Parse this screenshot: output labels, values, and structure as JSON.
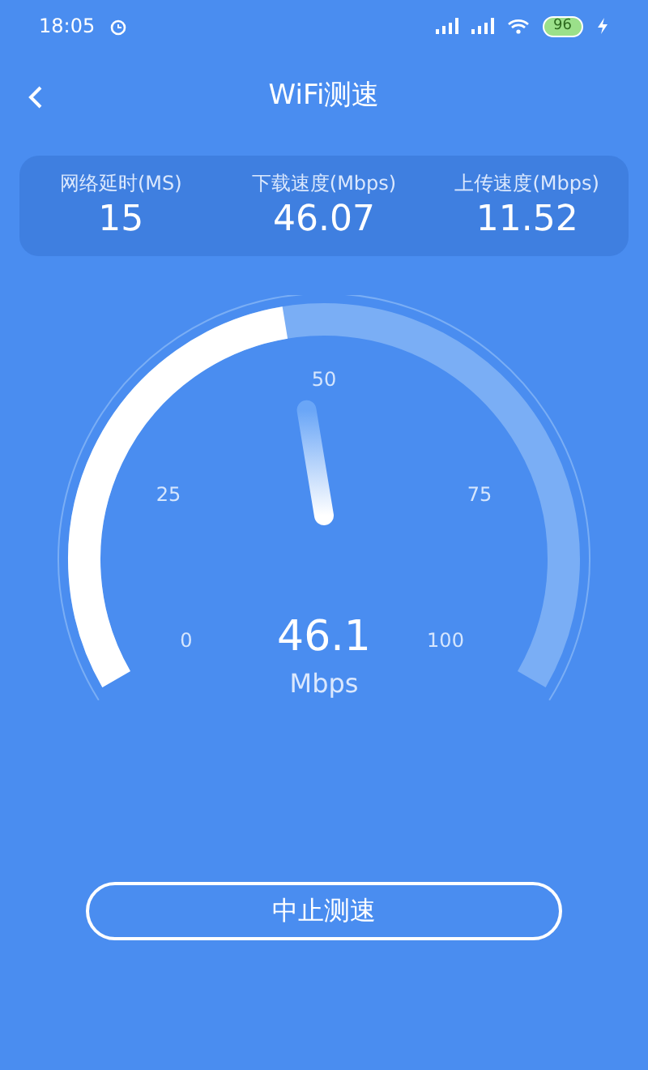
{
  "status_bar": {
    "time": "18:05",
    "battery": "96"
  },
  "header": {
    "title": "WiFi测速"
  },
  "stats": [
    {
      "label": "网络延时(MS)",
      "value": "15"
    },
    {
      "label": "下载速度(Mbps)",
      "value": "46.07"
    },
    {
      "label": "上传速度(Mbps)",
      "value": "11.52"
    }
  ],
  "gauge": {
    "ticks": [
      "0",
      "25",
      "50",
      "75",
      "100"
    ],
    "reading": "46.1",
    "unit": "Mbps"
  },
  "button": {
    "label": "中止测速"
  }
}
